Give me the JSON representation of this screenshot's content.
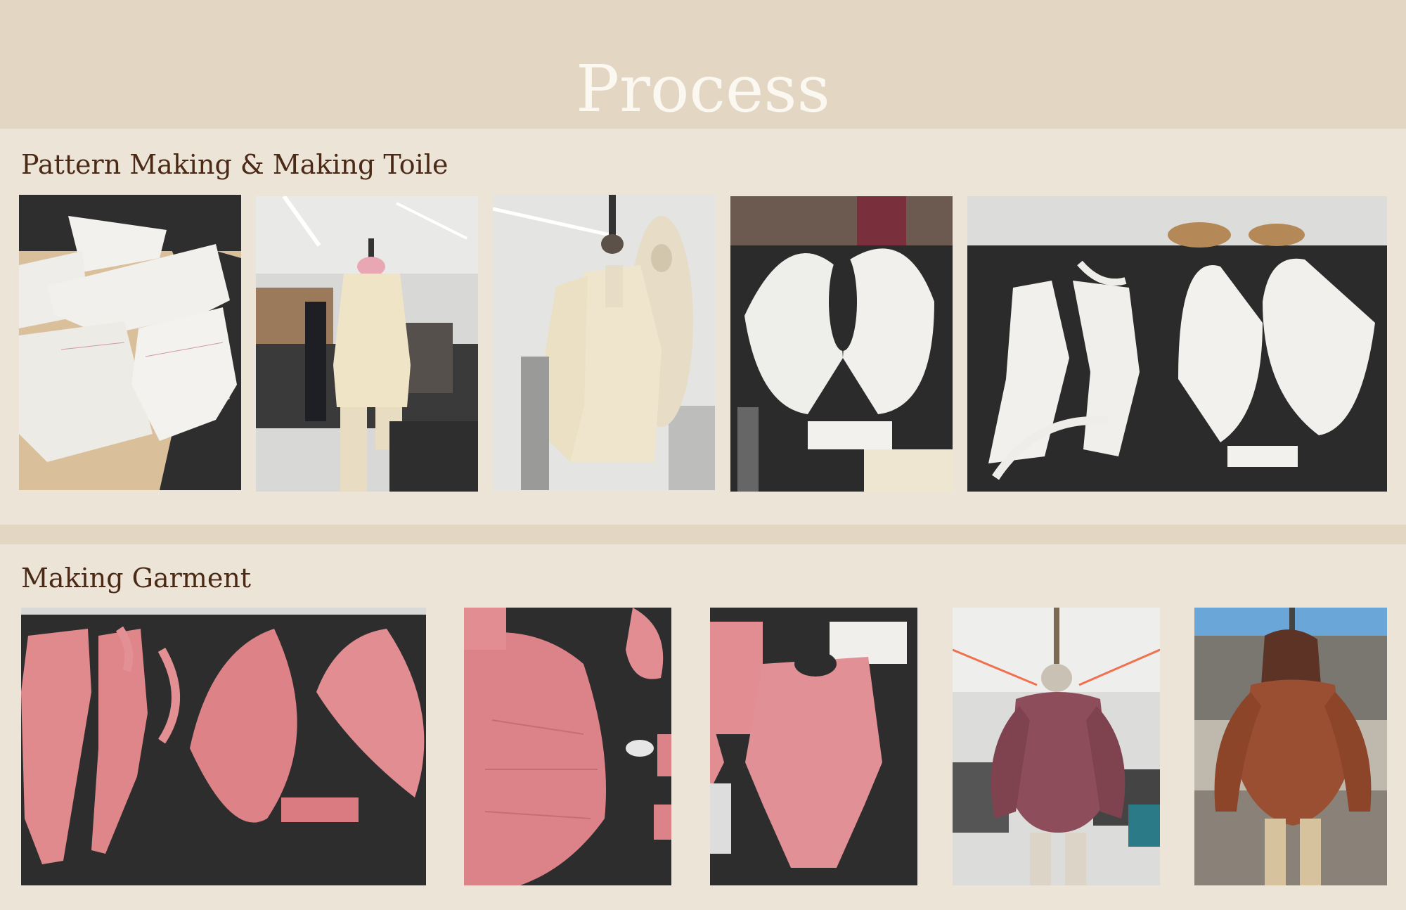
{
  "page": {
    "title": "Process"
  },
  "sections": [
    {
      "heading": "Pattern Making & Making Toile",
      "photos": [
        {
          "subject": "paper pattern pieces on table"
        },
        {
          "subject": "muslin toile bodice on dress form"
        },
        {
          "subject": "muslin toile with gathered sleeve on dress form"
        },
        {
          "subject": "radial sleeve pattern pieces on black table"
        },
        {
          "subject": "bodice and sleeve pattern pieces on black table"
        }
      ]
    },
    {
      "heading": "Making Garment",
      "photos": [
        {
          "subject": "pink fabric bodysuit pieces cut out"
        },
        {
          "subject": "gathered pink sleeve with pins"
        },
        {
          "subject": "assembled pink bodysuit on table"
        },
        {
          "subject": "mauve bodysuit with puff sleeves on dress form"
        },
        {
          "subject": "rust hooded bodysuit on dress form"
        }
      ]
    }
  ],
  "colors": {
    "background": "#ede4d8",
    "band": "#e3d6c2",
    "title": "#fbf7f1",
    "heading": "#4a2a16",
    "table_black": "#2b2b2b",
    "paper": "#f3f1ec",
    "muslin": "#efe4c6",
    "pink_fabric": "#d97a80",
    "mauve_fabric": "#8e4d5a",
    "rust_fabric": "#9a4f32"
  }
}
